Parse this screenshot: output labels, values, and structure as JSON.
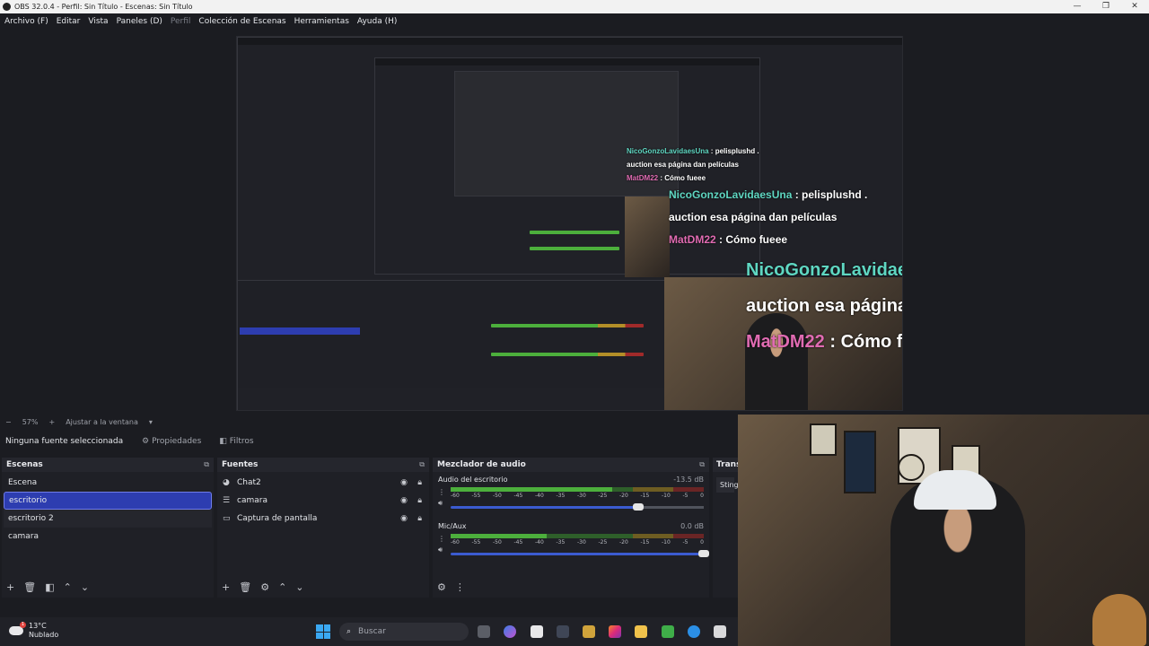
{
  "window": {
    "title": "OBS 32.0.4 - Perfil: Sin Título - Escenas: Sin Título",
    "controls": [
      "—",
      "❐",
      "✕"
    ]
  },
  "menu": [
    {
      "label": "Archivo (F)"
    },
    {
      "label": "Editar"
    },
    {
      "label": "Vista"
    },
    {
      "label": "Paneles (D)"
    },
    {
      "label": "Perfil"
    },
    {
      "label": "Colección de Escenas"
    },
    {
      "label": "Herramientas"
    },
    {
      "label": "Ayuda (H)"
    }
  ],
  "chat": [
    {
      "name": "NicoGonzoLavidaesUna",
      "sep": " : ",
      "text": "pelisplushd ."
    },
    {
      "name": "",
      "sep": "",
      "text": "auction esa página dan películas"
    },
    {
      "name": "MatDM22",
      "sep": " : ",
      "text": "Cómo fueee"
    }
  ],
  "zoom": {
    "minus": "−",
    "value": "57%",
    "plus": "+",
    "fit_label": "Ajustar a la ventana",
    "arrow": "▾"
  },
  "source_toolbar": {
    "no_source": "Ninguna fuente seleccionada",
    "properties_icon": "gear-icon",
    "properties_glyph": "⚙",
    "properties": "Propiedades",
    "filters_icon": "filter-icon",
    "filters_glyph": "◧",
    "filters": "Filtros"
  },
  "scenes": {
    "title": "Escenas",
    "items": [
      {
        "label": "Escena"
      },
      {
        "label": "escritorio"
      },
      {
        "label": "escritorio 2"
      },
      {
        "label": "camara"
      }
    ],
    "selected_index": 1
  },
  "sources": {
    "title": "Fuentes",
    "items": [
      {
        "label": "Chat2",
        "icon": "browser-icon",
        "glyph": "◕"
      },
      {
        "label": "camara",
        "icon": "list-icon",
        "glyph": "☰"
      },
      {
        "label": "Captura de pantalla",
        "icon": "monitor-icon",
        "glyph": "▭"
      }
    ]
  },
  "mixer": {
    "title": "Mezclador de audio",
    "ticks": [
      "-60",
      "-55",
      "-50",
      "-45",
      "-40",
      "-35",
      "-30",
      "-25",
      "-20",
      "-15",
      "-10",
      "-5",
      "0"
    ],
    "channels": [
      {
        "name": "Audio del escritorio",
        "db": "-13.5 dB",
        "level": 0.64,
        "volume": 0.74
      },
      {
        "name": "Mic/Aux",
        "db": "0.0 dB",
        "level": 0.38,
        "volume": 1.0
      }
    ]
  },
  "transitions": {
    "title": "Trans",
    "selected": "Sting"
  },
  "dock_buttons": {
    "scenes": [
      "+",
      "🗑",
      "◧",
      "⌃",
      "⌄"
    ],
    "sources": [
      "+",
      "🗑",
      "⚙",
      "⌃",
      "⌄"
    ],
    "mixer": [
      "⚙",
      "⋮"
    ]
  },
  "taskbar": {
    "temp": "13°C",
    "weather": "Nublado",
    "notification_count": "1",
    "search_placeholder": "Buscar"
  },
  "colors": {
    "accent": "#2d3db0",
    "meter_green": "#4caf3c",
    "chat_name_cyan": "#5fd7c2",
    "chat_name_pink": "#e06bb2"
  }
}
